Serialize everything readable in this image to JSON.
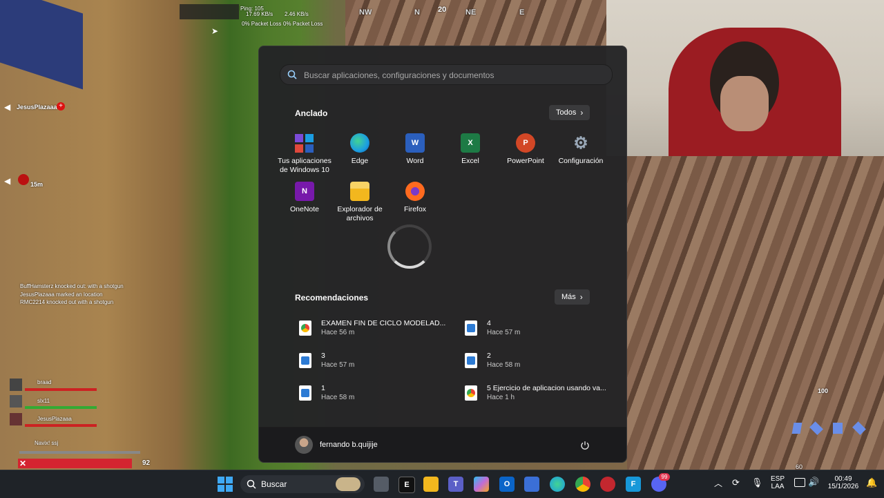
{
  "game": {
    "compass": [
      "NW",
      "N",
      "20",
      "NE",
      "E"
    ],
    "net_stats": [
      "Ping: 105",
      "17.69 KB/s",
      "0% Packet Loss",
      "2.46 KB/s",
      "0% Packet Loss"
    ],
    "markers": [
      {
        "label": "JesusPlazaaa"
      },
      {
        "label": "15m"
      }
    ],
    "feed": [
      "BuffHamsterz knocked out: with a shotgun",
      "JesusPlazaaa marked an location",
      "RMC2214 knocked out with a shotgun"
    ],
    "team": [
      {
        "name": "braad"
      },
      {
        "name": "slx11"
      },
      {
        "name": "JesusPlazaaa"
      },
      {
        "name": "Navix! ssj"
      }
    ],
    "health_value": "92",
    "ammo_value": "100",
    "weapon_ammo": "60"
  },
  "start_menu": {
    "search_placeholder": "Buscar aplicaciones, configuraciones y documentos",
    "pinned_title": "Anclado",
    "all_button": "Todos",
    "pinned_apps": [
      {
        "label": "Tus aplicaciones de Windows 10",
        "icon": "windows-apps-icon",
        "color": "#7b4bd8"
      },
      {
        "label": "Edge",
        "icon": "edge-icon",
        "color": "#1b9de2"
      },
      {
        "label": "Word",
        "icon": "word-icon",
        "color": "#2b5fbd"
      },
      {
        "label": "Excel",
        "icon": "excel-icon",
        "color": "#1d7a45"
      },
      {
        "label": "PowerPoint",
        "icon": "powerpoint-icon",
        "color": "#d24726"
      },
      {
        "label": "Configuración",
        "icon": "settings-icon",
        "color": "#6b7b8c"
      },
      {
        "label": "OneNote",
        "icon": "onenote-icon",
        "color": "#7719aa"
      },
      {
        "label": "Explorador de archivos",
        "icon": "folder-icon",
        "color": "#f2c12e"
      },
      {
        "label": "Firefox",
        "icon": "firefox-icon",
        "color": "#ff6a1f"
      }
    ],
    "recommendations_title": "Recomendaciones",
    "more_button": "Más",
    "recommendations": [
      {
        "name": "EXAMEN FIN DE CICLO MODELAD...",
        "time": "Hace 56 m",
        "icon": "chrome-doc-icon"
      },
      {
        "name": "4",
        "time": "Hace 57 m",
        "icon": "image-file-icon"
      },
      {
        "name": "3",
        "time": "Hace 57 m",
        "icon": "image-file-icon"
      },
      {
        "name": "2",
        "time": "Hace 58 m",
        "icon": "image-file-icon"
      },
      {
        "name": "1",
        "time": "Hace 58 m",
        "icon": "image-file-icon"
      },
      {
        "name": "5 Ejercicio de aplicacion usando va...",
        "time": "Hace 1 h",
        "icon": "chrome-doc-icon"
      }
    ],
    "user_name": "fernando b.quijije"
  },
  "taskbar": {
    "search_label": "Buscar",
    "language": "ESP",
    "layout": "LAA",
    "time": "00:49",
    "date": "15/1/2026",
    "discord_badge": "99"
  }
}
